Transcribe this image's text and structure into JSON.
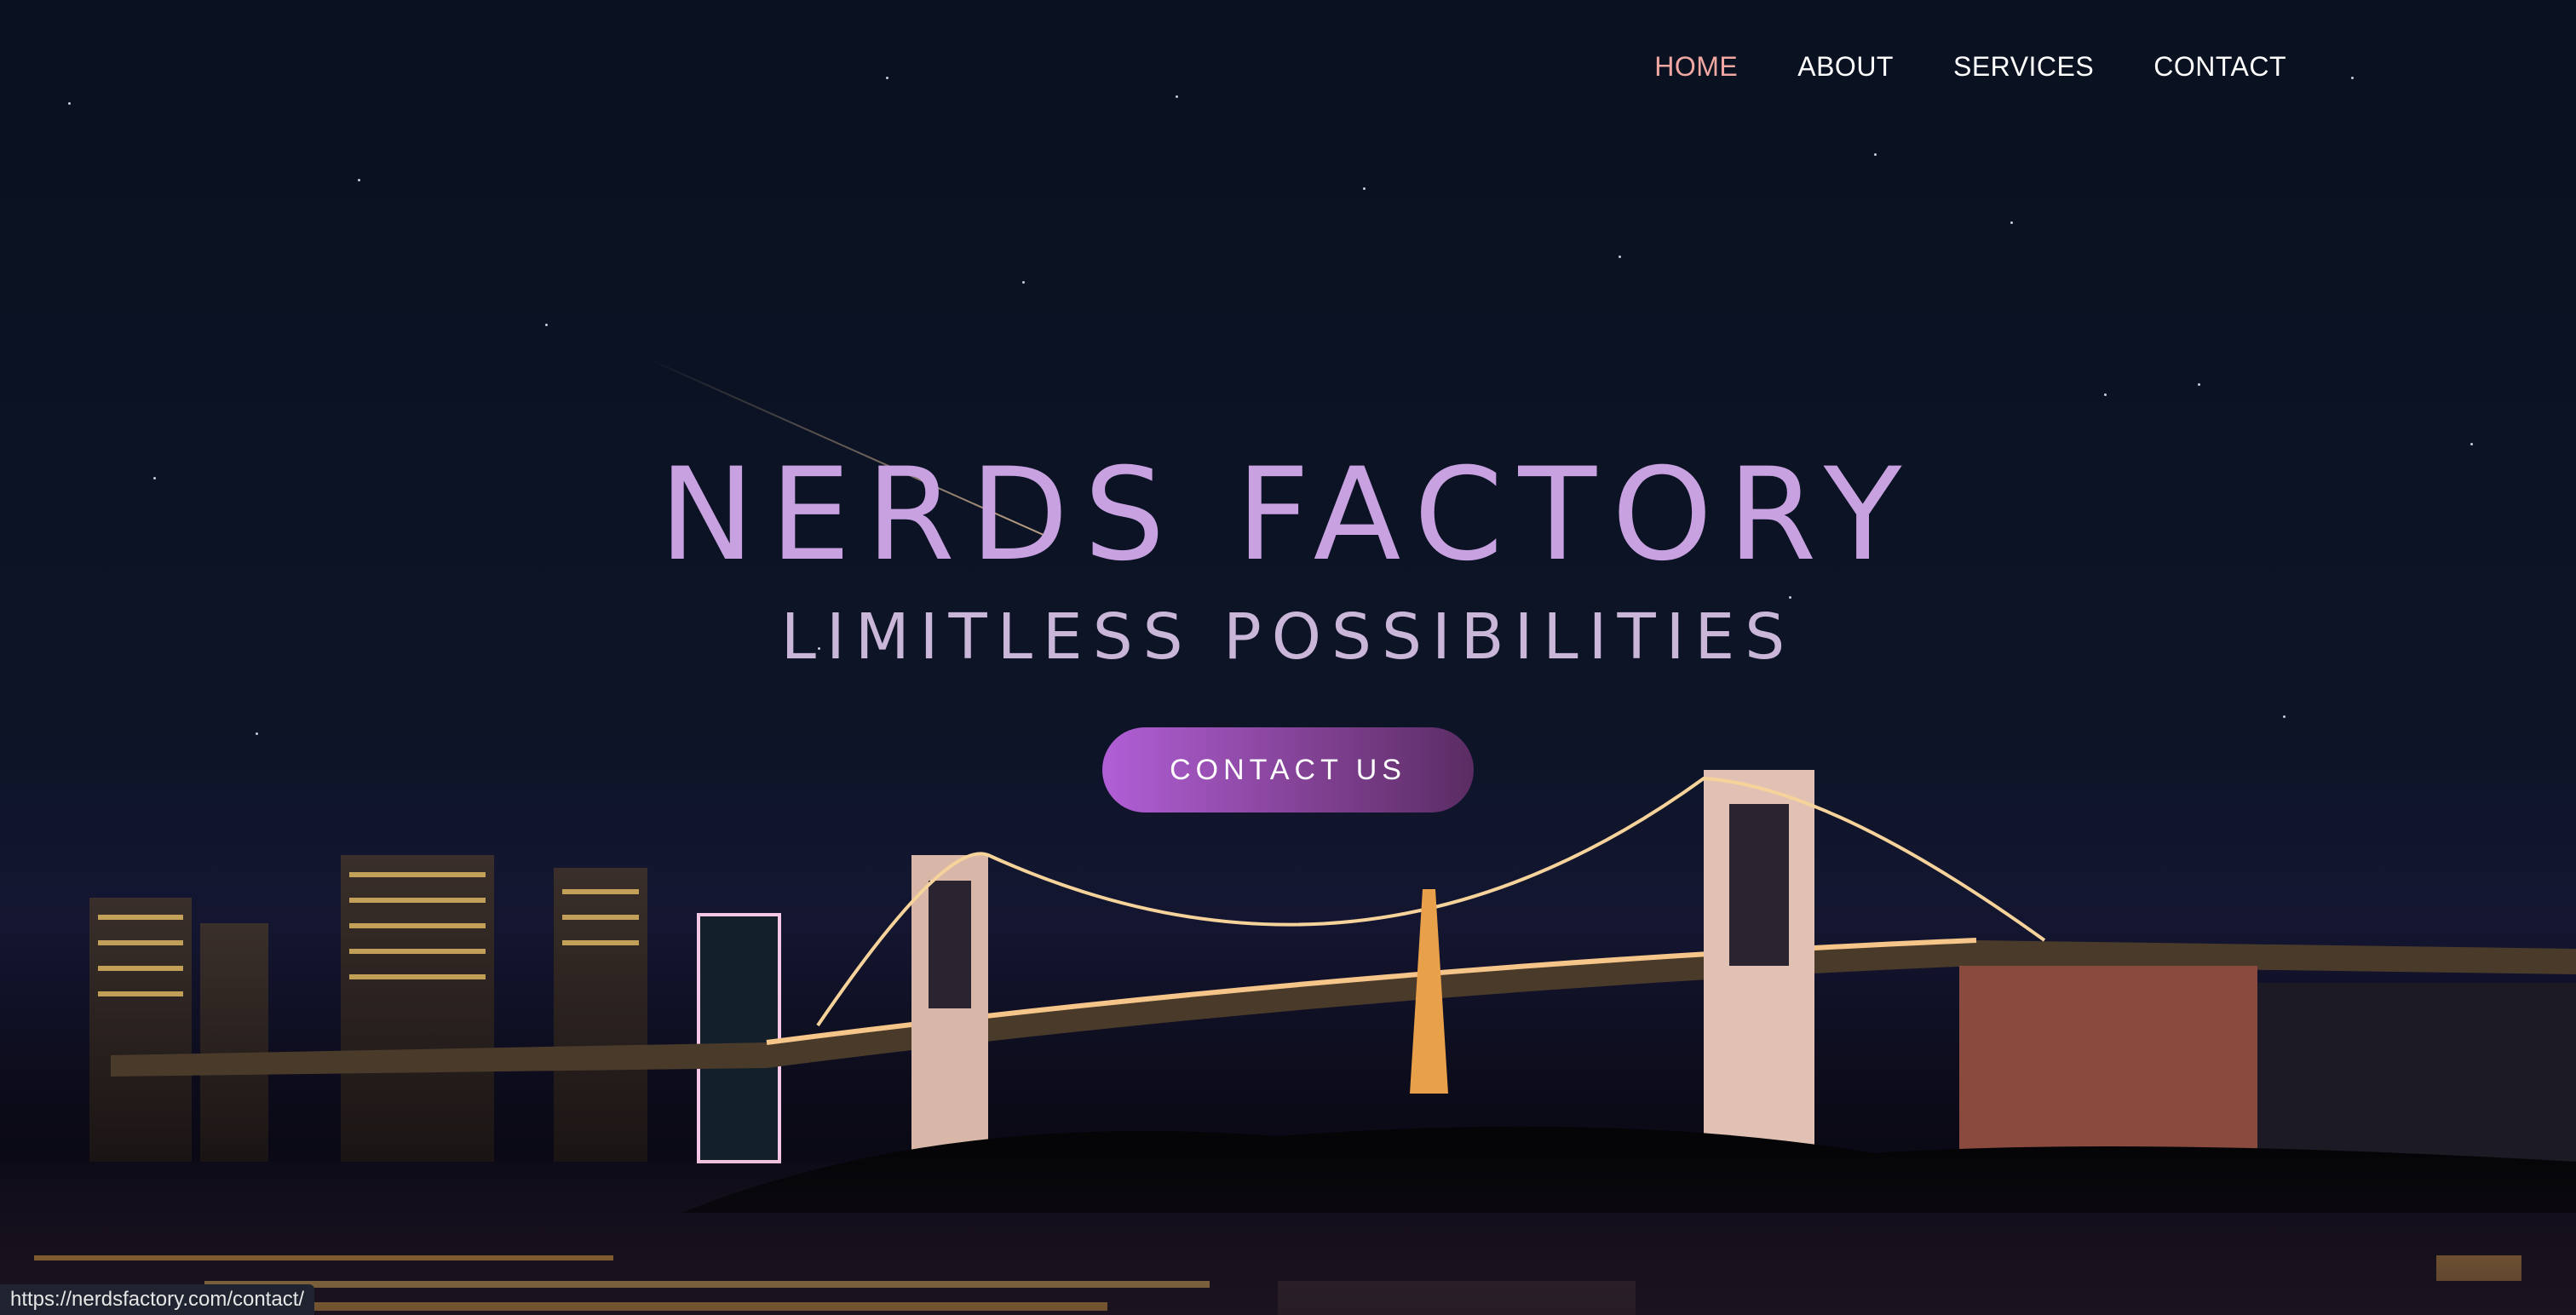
{
  "nav": {
    "items": [
      {
        "label": "HOME",
        "active": true
      },
      {
        "label": "ABOUT",
        "active": false
      },
      {
        "label": "SERVICES",
        "active": false
      },
      {
        "label": "CONTACT",
        "active": false
      }
    ]
  },
  "hero": {
    "title": "NERDS FACTORY",
    "subtitle": "LIMITLESS POSSIBILITIES",
    "cta_label": "CONTACT US"
  },
  "status_bar": {
    "url": "https://nerdsfactory.com/contact/"
  },
  "colors": {
    "nav_active": "#f2a8a2",
    "title": "#c8a1e0",
    "cta_gradient_start": "#b15fd6",
    "cta_gradient_end": "#5a2c63"
  }
}
